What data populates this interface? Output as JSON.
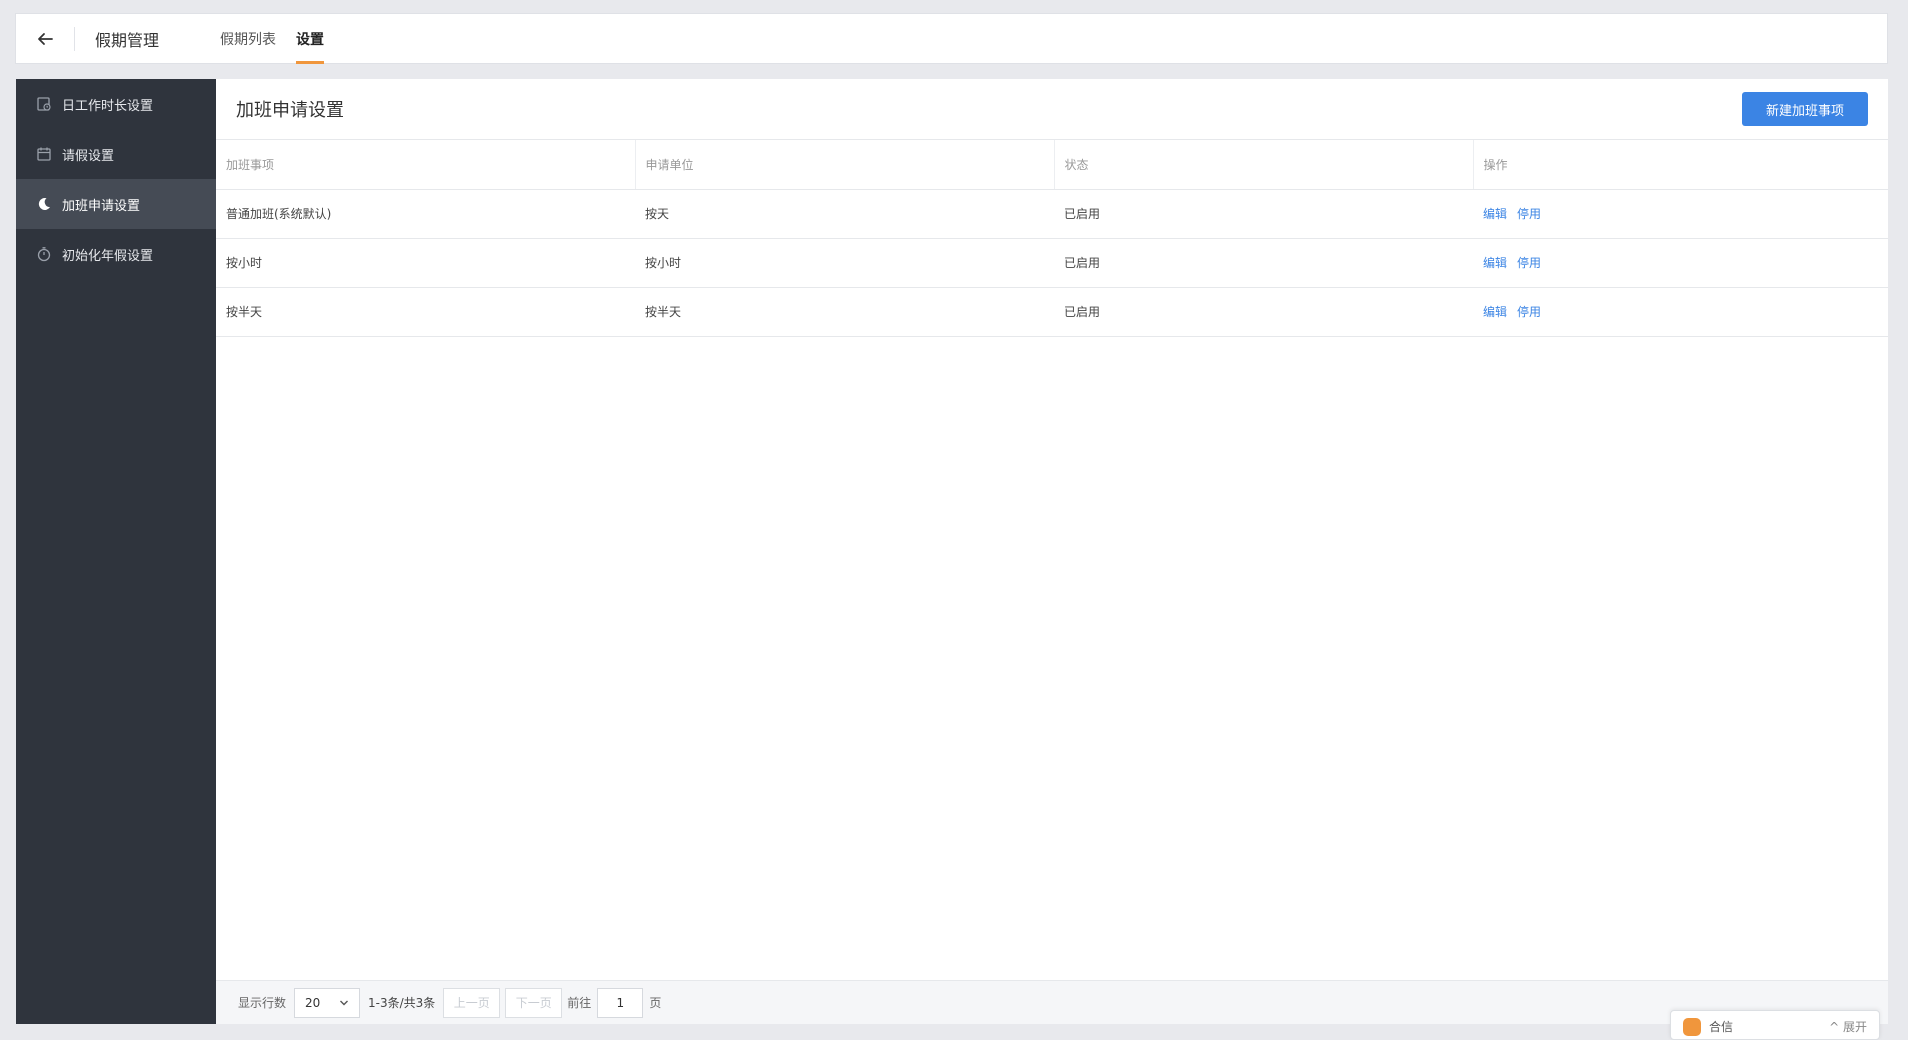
{
  "header": {
    "title": "假期管理",
    "tabs": [
      {
        "label": "假期列表",
        "active": false
      },
      {
        "label": "设置",
        "active": true
      }
    ]
  },
  "sidebar": {
    "items": [
      {
        "label": "日工作时长设置",
        "icon": "clock-calendar-icon",
        "active": false
      },
      {
        "label": "请假设置",
        "icon": "calendar-icon",
        "active": false
      },
      {
        "label": "加班申请设置",
        "icon": "moon-icon",
        "active": true
      },
      {
        "label": "初始化年假设置",
        "icon": "timer-icon",
        "active": false
      }
    ]
  },
  "main": {
    "title": "加班申请设置",
    "new_button_label": "新建加班事项",
    "table": {
      "columns": [
        "加班事项",
        "申请单位",
        "状态",
        "操作"
      ],
      "rows": [
        {
          "item": "普通加班(系统默认)",
          "unit": "按天",
          "status": "已启用",
          "edit": "编辑",
          "disable": "停用"
        },
        {
          "item": "按小时",
          "unit": "按小时",
          "status": "已启用",
          "edit": "编辑",
          "disable": "停用"
        },
        {
          "item": "按半天",
          "unit": "按半天",
          "status": "已启用",
          "edit": "编辑",
          "disable": "停用"
        }
      ]
    }
  },
  "pagination": {
    "rows_label": "显示行数",
    "page_size": "20",
    "range_text": "1-3条/共3条",
    "prev_label": "上一页",
    "next_label": "下一页",
    "goto_label": "前往",
    "goto_value": "1",
    "page_suffix": "页"
  },
  "float_widget": {
    "text": "合信",
    "right_text": "^ 展开"
  },
  "colors": {
    "accent": "#3b84e4",
    "tab_underline": "#f0963c",
    "sidebar_bg": "#2f343d",
    "sidebar_active_bg": "#454b55"
  }
}
